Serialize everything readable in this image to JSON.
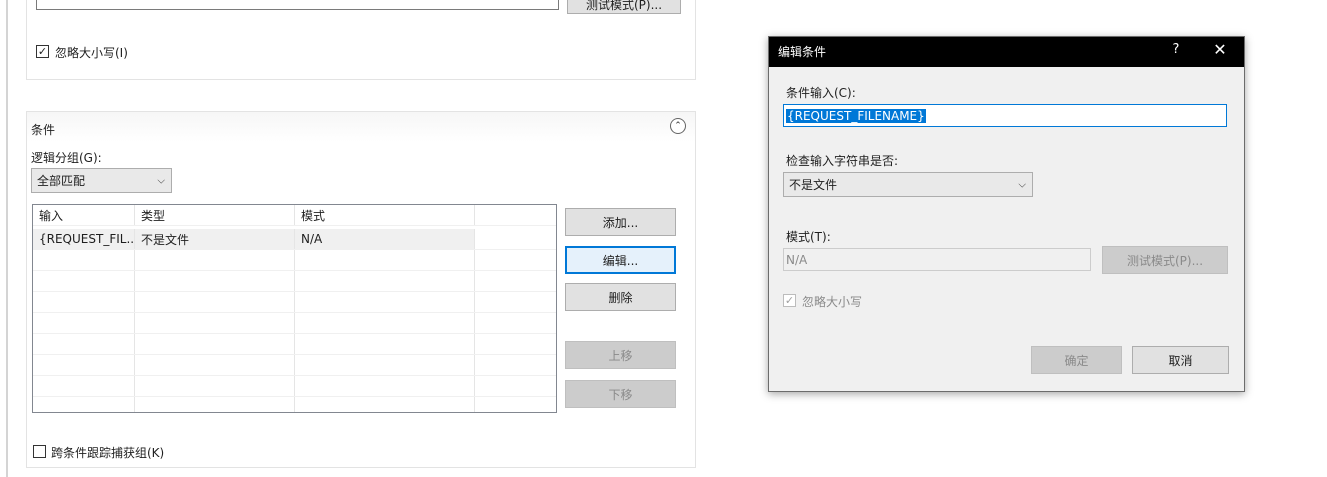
{
  "top_section": {
    "test_pattern_button": "测试模式(P)...",
    "ignore_case_label": "忽略大小写(I)",
    "ignore_case_checked": true
  },
  "conditions": {
    "title": "条件",
    "logical_grouping_label": "逻辑分组(G):",
    "logical_grouping_value": "全部匹配",
    "columns": [
      "输入",
      "类型",
      "模式"
    ],
    "rows": [
      {
        "input": "{REQUEST_FIL...",
        "type": "不是文件",
        "pattern": "N/A"
      }
    ],
    "buttons": {
      "add": "添加...",
      "edit": "编辑...",
      "remove": "删除",
      "move_up": "上移",
      "move_down": "下移"
    },
    "track_capture_label": "跨条件跟踪捕获组(K)",
    "track_capture_checked": false
  },
  "dialog": {
    "title": "编辑条件",
    "help_icon": "?",
    "close_icon": "✕",
    "condition_input_label": "条件输入(C):",
    "condition_input_value": "{REQUEST_FILENAME}",
    "check_if_label": "检查输入字符串是否:",
    "check_if_value": "不是文件",
    "pattern_label": "模式(T):",
    "pattern_value": "N/A",
    "test_pattern_button": "测试模式(P)...",
    "ignore_case_label": "忽略大小写",
    "ignore_case_checked": true,
    "ok_button": "确定",
    "cancel_button": "取消"
  },
  "colors": {
    "accent": "#0078d7",
    "title_bar": "#000000",
    "dialog_bg": "#f0f0f0"
  }
}
